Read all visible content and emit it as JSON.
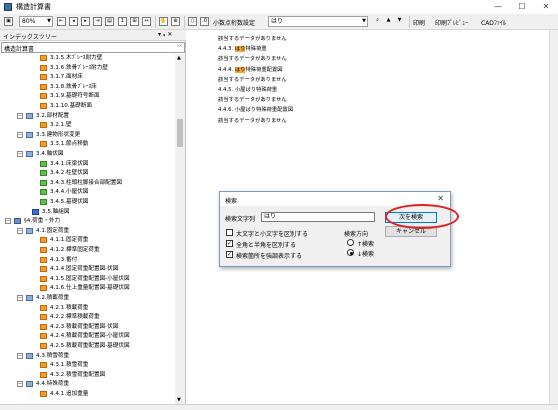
{
  "window": {
    "title": "構造計算書",
    "minimize": "—",
    "maximize": "☐",
    "close": "✕"
  },
  "toolbar": {
    "zoom": "80%",
    "decimal_button": "小数点桁数設定",
    "search_text": "はり",
    "print": "印刷",
    "print_preview": "印刷ﾌﾟﾚﾋﾞｭｰ",
    "cad": "CADﾌｧｲﾙ"
  },
  "panel": {
    "title": "インデックスツリー",
    "pin": "▾ ᵩ ✕",
    "combo_value": "構造計算書"
  },
  "tree": [
    {
      "label": "3.1.5.木ﾌﾞﾚｰｽ耐力壁",
      "icon": "page"
    },
    {
      "label": "3.1.6.鉄骨ﾌﾞﾚｰｽ耐力壁",
      "icon": "page"
    },
    {
      "label": "3.1.7.面材床",
      "icon": "page"
    },
    {
      "label": "3.1.8.鉄骨ﾌﾞﾚｰｽ床",
      "icon": "page"
    },
    {
      "label": "3.1.9.基礎符号断面",
      "icon": "page"
    },
    {
      "label": "3.1.10.基礎断面",
      "icon": "page"
    },
    {
      "label": "3.2.部材配置",
      "icon": "folder",
      "exp": "−"
    },
    {
      "label": "3.2.1.壁",
      "icon": "page"
    },
    {
      "label": "3.3.建物形状変更",
      "icon": "folder",
      "exp": "−"
    },
    {
      "label": "3.3.1.節点移動",
      "icon": "page"
    },
    {
      "label": "3.4.軸伏図",
      "icon": "folder",
      "exp": "−"
    },
    {
      "label": "3.4.1.床梁伏図",
      "icon": "grid"
    },
    {
      "label": "3.4.2.柱壁伏図",
      "icon": "grid"
    },
    {
      "label": "3.4.3.柱頭柱脚接合部配置図",
      "icon": "grid"
    },
    {
      "label": "3.4.4.小屋伏図",
      "icon": "grid"
    },
    {
      "label": "3.4.5.基礎伏図",
      "icon": "grid"
    },
    {
      "label": "3.5.軸組図",
      "icon": "blue"
    },
    {
      "label": "§4.荷重・外力",
      "icon": "root",
      "exp": "−"
    },
    {
      "label": "4.1.固定荷重",
      "icon": "folder",
      "exp": "−"
    },
    {
      "label": "4.1.1.固定荷重",
      "icon": "page"
    },
    {
      "label": "4.1.2.標準固定荷重",
      "icon": "page"
    },
    {
      "label": "4.1.3.番付",
      "icon": "page"
    },
    {
      "label": "4.1.4.固定荷重配置図-伏図",
      "icon": "page"
    },
    {
      "label": "4.1.5.固定荷重配置図-小屋伏図",
      "icon": "page"
    },
    {
      "label": "4.1.6.仕上重量配置図-基礎伏図",
      "icon": "page"
    },
    {
      "label": "4.2.積載荷重",
      "icon": "folder",
      "exp": "−"
    },
    {
      "label": "4.2.1.積載荷重",
      "icon": "page"
    },
    {
      "label": "4.2.2.標準積載荷重",
      "icon": "page"
    },
    {
      "label": "4.2.3.積載荷重配置図-伏図",
      "icon": "page"
    },
    {
      "label": "4.2.4.積載荷重配置図-小屋伏図",
      "icon": "page"
    },
    {
      "label": "4.2.5.積載荷重配置図-基礎伏図",
      "icon": "page"
    },
    {
      "label": "4.3.積雪荷重",
      "icon": "folder",
      "exp": "−"
    },
    {
      "label": "4.3.1.積雪荷重",
      "icon": "page"
    },
    {
      "label": "4.3.2.積雪荷重配置図",
      "icon": "page"
    },
    {
      "label": "4.4.特殊荷重",
      "icon": "folder",
      "exp": "−"
    },
    {
      "label": "4.4.1.追加重量",
      "icon": "page"
    }
  ],
  "document": {
    "lines": [
      {
        "pre": "該当するデータがありません",
        "hl": "",
        "post": ""
      },
      {
        "pre": "4.4.3. ",
        "hl": "はり",
        "post": "特殊荷重"
      },
      {
        "pre": "該当するデータがありません",
        "hl": "",
        "post": ""
      },
      {
        "pre": "4.4.4. ",
        "hl": "はり",
        "post": "特殊荷重配置図"
      },
      {
        "pre": "該当するデータがありません",
        "hl": "",
        "post": ""
      },
      {
        "pre": "4.4.5. 小屋ばり特殊荷重",
        "hl": "",
        "post": ""
      },
      {
        "pre": "該当するデータがありません",
        "hl": "",
        "post": ""
      },
      {
        "pre": "4.4.6. 小屋ばり特殊荷重配置図",
        "hl": "",
        "post": ""
      },
      {
        "pre": "該当するデータがありません",
        "hl": "",
        "post": ""
      }
    ]
  },
  "dialog": {
    "title": "検索",
    "search_label": "検索文字列",
    "search_value": "はり",
    "find_next": "次を検索",
    "cancel": "キャンセル",
    "opt_case": "大文字と小文字を区別する",
    "opt_width": "全角と半角を区別する",
    "opt_highlight": "検索箇所を強調表示する",
    "direction_label": "検索方向",
    "dir_up": "↑検索",
    "dir_down": "↓検索",
    "case_checked": false,
    "width_checked": true,
    "highlight_checked": true,
    "direction": "down"
  }
}
